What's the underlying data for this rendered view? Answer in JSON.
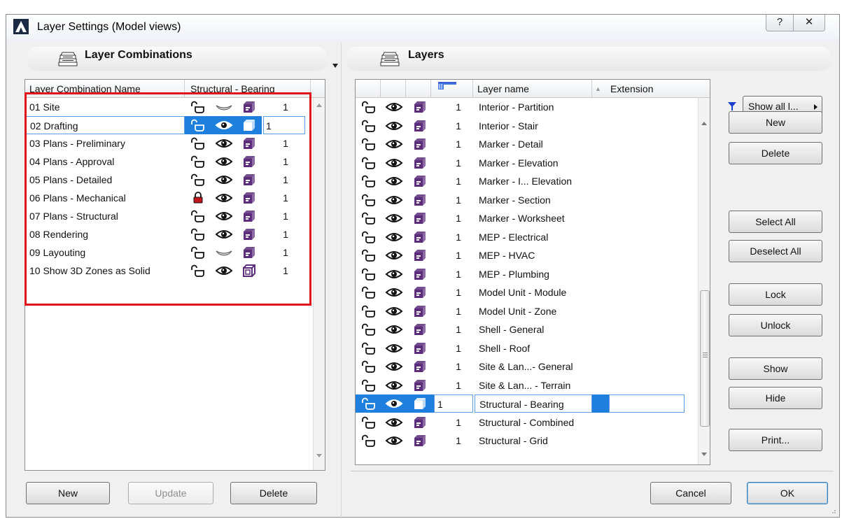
{
  "window": {
    "title": "Layer Settings (Model views)",
    "help_label": "?",
    "close_label": "✕"
  },
  "colors": {
    "selection_blue": "#1f7fdc",
    "highlight_red": "#e0141b",
    "layer_icon_purple": "#5b2d7a",
    "filter_blue": "#1a3fcf"
  },
  "combinations": {
    "title": "Layer Combinations",
    "column_name": "Layer Combination Name",
    "column_layer": "Structural - Bearing",
    "rows": [
      {
        "name": "01 Site",
        "lock": "unlocked",
        "show": "hidden",
        "mode": "solid",
        "pen": "1"
      },
      {
        "name": "02 Drafting",
        "lock": "unlocked",
        "show": "visible",
        "mode": "solid",
        "pen": "1",
        "selected": true
      },
      {
        "name": "03 Plans - Preliminary",
        "lock": "unlocked",
        "show": "visible",
        "mode": "solid",
        "pen": "1"
      },
      {
        "name": "04 Plans - Approval",
        "lock": "unlocked",
        "show": "visible",
        "mode": "solid",
        "pen": "1"
      },
      {
        "name": "05 Plans - Detailed",
        "lock": "unlocked",
        "show": "visible",
        "mode": "solid",
        "pen": "1"
      },
      {
        "name": "06 Plans - Mechanical",
        "lock": "locked",
        "show": "visible",
        "mode": "solid",
        "pen": "1"
      },
      {
        "name": "07 Plans - Structural",
        "lock": "unlocked",
        "show": "visible",
        "mode": "solid",
        "pen": "1"
      },
      {
        "name": "08 Rendering",
        "lock": "unlocked",
        "show": "visible",
        "mode": "solid",
        "pen": "1"
      },
      {
        "name": "09 Layouting",
        "lock": "unlocked",
        "show": "hidden",
        "mode": "solid",
        "pen": "1"
      },
      {
        "name": "10 Show 3D Zones as Solid",
        "lock": "unlocked",
        "show": "visible",
        "mode": "wire",
        "pen": "1"
      }
    ],
    "buttons": {
      "new": "New",
      "update": "Update",
      "delete": "Delete"
    }
  },
  "layers": {
    "title": "Layers",
    "column_name": "Layer name",
    "column_extension": "Extension",
    "sort_indicator": "▲",
    "rows": [
      {
        "pen": "1",
        "name": "Interior - Partition"
      },
      {
        "pen": "1",
        "name": "Interior - Stair"
      },
      {
        "pen": "1",
        "name": "Marker - Detail"
      },
      {
        "pen": "1",
        "name": "Marker - Elevation"
      },
      {
        "pen": "1",
        "name": "Marker - I... Elevation"
      },
      {
        "pen": "1",
        "name": "Marker - Section"
      },
      {
        "pen": "1",
        "name": "Marker - Worksheet"
      },
      {
        "pen": "1",
        "name": "MEP - Electrical"
      },
      {
        "pen": "1",
        "name": "MEP - HVAC"
      },
      {
        "pen": "1",
        "name": "MEP - Plumbing"
      },
      {
        "pen": "1",
        "name": "Model Unit - Module"
      },
      {
        "pen": "1",
        "name": "Model Unit - Zone"
      },
      {
        "pen": "1",
        "name": "Shell - General"
      },
      {
        "pen": "1",
        "name": "Shell - Roof"
      },
      {
        "pen": "1",
        "name": "Site & Lan...- General"
      },
      {
        "pen": "1",
        "name": "Site & Lan... - Terrain"
      },
      {
        "pen": "1",
        "name": "Structural - Bearing",
        "selected": true
      },
      {
        "pen": "1",
        "name": "Structural - Combined"
      },
      {
        "pen": "1",
        "name": "Structural - Grid"
      }
    ],
    "show_filter_label": "Show all l...",
    "buttons": {
      "new": "New",
      "delete": "Delete",
      "select_all": "Select All",
      "deselect_all": "Deselect All",
      "lock": "Lock",
      "unlock": "Unlock",
      "show": "Show",
      "hide": "Hide",
      "print": "Print..."
    }
  },
  "footer": {
    "cancel": "Cancel",
    "ok": "OK"
  }
}
